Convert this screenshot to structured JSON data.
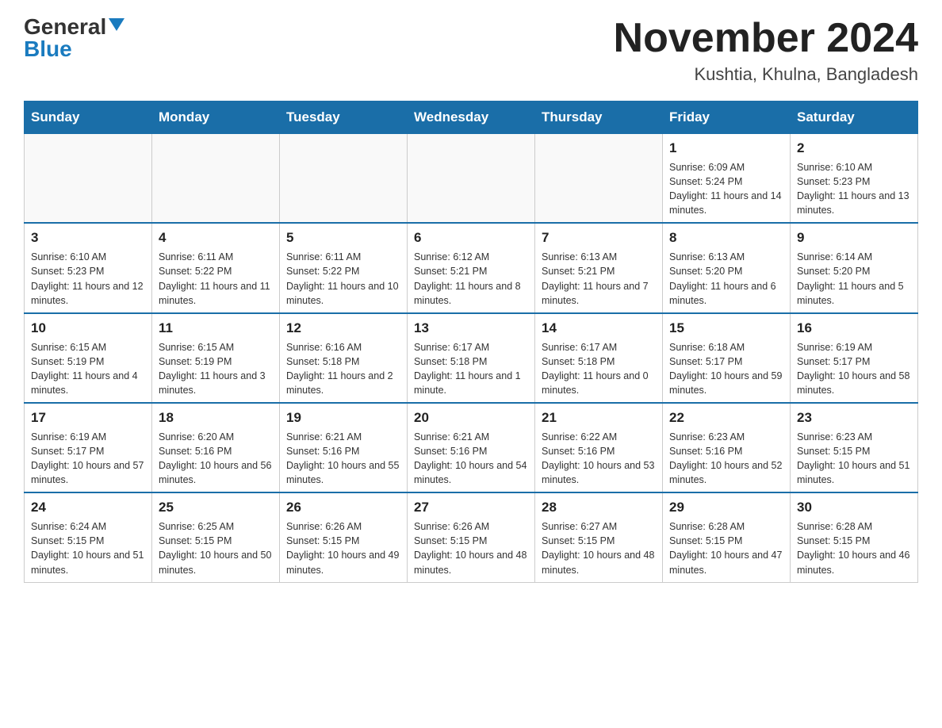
{
  "logo": {
    "general": "General",
    "blue": "Blue"
  },
  "title": {
    "month_year": "November 2024",
    "location": "Kushtia, Khulna, Bangladesh"
  },
  "days_of_week": [
    "Sunday",
    "Monday",
    "Tuesday",
    "Wednesday",
    "Thursday",
    "Friday",
    "Saturday"
  ],
  "weeks": [
    [
      {
        "day": "",
        "info": ""
      },
      {
        "day": "",
        "info": ""
      },
      {
        "day": "",
        "info": ""
      },
      {
        "day": "",
        "info": ""
      },
      {
        "day": "",
        "info": ""
      },
      {
        "day": "1",
        "info": "Sunrise: 6:09 AM\nSunset: 5:24 PM\nDaylight: 11 hours and 14 minutes."
      },
      {
        "day": "2",
        "info": "Sunrise: 6:10 AM\nSunset: 5:23 PM\nDaylight: 11 hours and 13 minutes."
      }
    ],
    [
      {
        "day": "3",
        "info": "Sunrise: 6:10 AM\nSunset: 5:23 PM\nDaylight: 11 hours and 12 minutes."
      },
      {
        "day": "4",
        "info": "Sunrise: 6:11 AM\nSunset: 5:22 PM\nDaylight: 11 hours and 11 minutes."
      },
      {
        "day": "5",
        "info": "Sunrise: 6:11 AM\nSunset: 5:22 PM\nDaylight: 11 hours and 10 minutes."
      },
      {
        "day": "6",
        "info": "Sunrise: 6:12 AM\nSunset: 5:21 PM\nDaylight: 11 hours and 8 minutes."
      },
      {
        "day": "7",
        "info": "Sunrise: 6:13 AM\nSunset: 5:21 PM\nDaylight: 11 hours and 7 minutes."
      },
      {
        "day": "8",
        "info": "Sunrise: 6:13 AM\nSunset: 5:20 PM\nDaylight: 11 hours and 6 minutes."
      },
      {
        "day": "9",
        "info": "Sunrise: 6:14 AM\nSunset: 5:20 PM\nDaylight: 11 hours and 5 minutes."
      }
    ],
    [
      {
        "day": "10",
        "info": "Sunrise: 6:15 AM\nSunset: 5:19 PM\nDaylight: 11 hours and 4 minutes."
      },
      {
        "day": "11",
        "info": "Sunrise: 6:15 AM\nSunset: 5:19 PM\nDaylight: 11 hours and 3 minutes."
      },
      {
        "day": "12",
        "info": "Sunrise: 6:16 AM\nSunset: 5:18 PM\nDaylight: 11 hours and 2 minutes."
      },
      {
        "day": "13",
        "info": "Sunrise: 6:17 AM\nSunset: 5:18 PM\nDaylight: 11 hours and 1 minute."
      },
      {
        "day": "14",
        "info": "Sunrise: 6:17 AM\nSunset: 5:18 PM\nDaylight: 11 hours and 0 minutes."
      },
      {
        "day": "15",
        "info": "Sunrise: 6:18 AM\nSunset: 5:17 PM\nDaylight: 10 hours and 59 minutes."
      },
      {
        "day": "16",
        "info": "Sunrise: 6:19 AM\nSunset: 5:17 PM\nDaylight: 10 hours and 58 minutes."
      }
    ],
    [
      {
        "day": "17",
        "info": "Sunrise: 6:19 AM\nSunset: 5:17 PM\nDaylight: 10 hours and 57 minutes."
      },
      {
        "day": "18",
        "info": "Sunrise: 6:20 AM\nSunset: 5:16 PM\nDaylight: 10 hours and 56 minutes."
      },
      {
        "day": "19",
        "info": "Sunrise: 6:21 AM\nSunset: 5:16 PM\nDaylight: 10 hours and 55 minutes."
      },
      {
        "day": "20",
        "info": "Sunrise: 6:21 AM\nSunset: 5:16 PM\nDaylight: 10 hours and 54 minutes."
      },
      {
        "day": "21",
        "info": "Sunrise: 6:22 AM\nSunset: 5:16 PM\nDaylight: 10 hours and 53 minutes."
      },
      {
        "day": "22",
        "info": "Sunrise: 6:23 AM\nSunset: 5:16 PM\nDaylight: 10 hours and 52 minutes."
      },
      {
        "day": "23",
        "info": "Sunrise: 6:23 AM\nSunset: 5:15 PM\nDaylight: 10 hours and 51 minutes."
      }
    ],
    [
      {
        "day": "24",
        "info": "Sunrise: 6:24 AM\nSunset: 5:15 PM\nDaylight: 10 hours and 51 minutes."
      },
      {
        "day": "25",
        "info": "Sunrise: 6:25 AM\nSunset: 5:15 PM\nDaylight: 10 hours and 50 minutes."
      },
      {
        "day": "26",
        "info": "Sunrise: 6:26 AM\nSunset: 5:15 PM\nDaylight: 10 hours and 49 minutes."
      },
      {
        "day": "27",
        "info": "Sunrise: 6:26 AM\nSunset: 5:15 PM\nDaylight: 10 hours and 48 minutes."
      },
      {
        "day": "28",
        "info": "Sunrise: 6:27 AM\nSunset: 5:15 PM\nDaylight: 10 hours and 48 minutes."
      },
      {
        "day": "29",
        "info": "Sunrise: 6:28 AM\nSunset: 5:15 PM\nDaylight: 10 hours and 47 minutes."
      },
      {
        "day": "30",
        "info": "Sunrise: 6:28 AM\nSunset: 5:15 PM\nDaylight: 10 hours and 46 minutes."
      }
    ]
  ]
}
